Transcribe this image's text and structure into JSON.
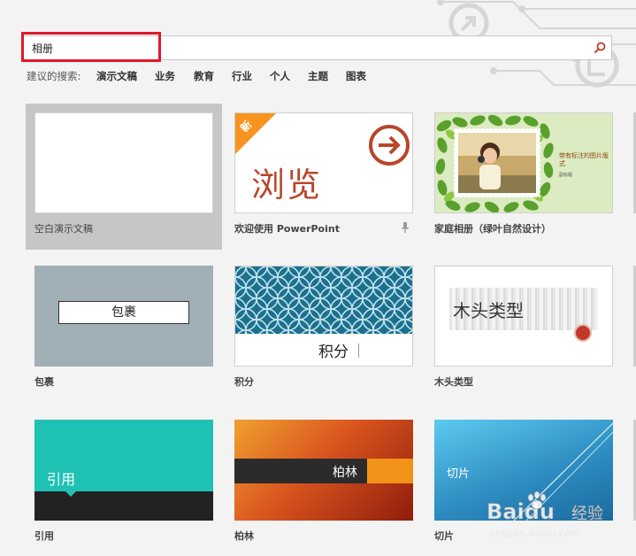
{
  "search": {
    "value": "相册",
    "placeholder": ""
  },
  "suggestions": {
    "label": "建议的搜索:",
    "items": [
      "演示文稿",
      "业务",
      "教育",
      "行业",
      "个人",
      "主题",
      "图表"
    ]
  },
  "templates": [
    {
      "caption": "空白演示文稿"
    },
    {
      "caption": "欢迎使用 PowerPoint",
      "badge": "新",
      "thumb_text": "浏览"
    },
    {
      "caption": "家庭相册（绿叶自然设计）",
      "thumb_text": "带有标注的图片版式",
      "thumb_subtext": "副标题"
    },
    {
      "caption": "包裹",
      "thumb_text": "包裹"
    },
    {
      "caption": "积分",
      "thumb_text": "积分"
    },
    {
      "caption": "木头类型",
      "thumb_text": "木头类型"
    },
    {
      "caption": "引用",
      "thumb_text": "引用"
    },
    {
      "caption": "柏林",
      "thumb_text": "柏林"
    },
    {
      "caption": "切片",
      "thumb_text": "切片"
    }
  ],
  "watermark": {
    "brand": "Baidu",
    "suffix": "经验",
    "url": "jingyan.baidu.com"
  },
  "colors": {
    "highlight": "#e0182a",
    "accent": "#b7472a",
    "badge": "#f7931e",
    "teal": "#1fc1b4",
    "parcel": "#a1b0b6",
    "integral": "#1c6f8d",
    "berlin": "#d9541e",
    "slice": "#2f8ec2"
  }
}
